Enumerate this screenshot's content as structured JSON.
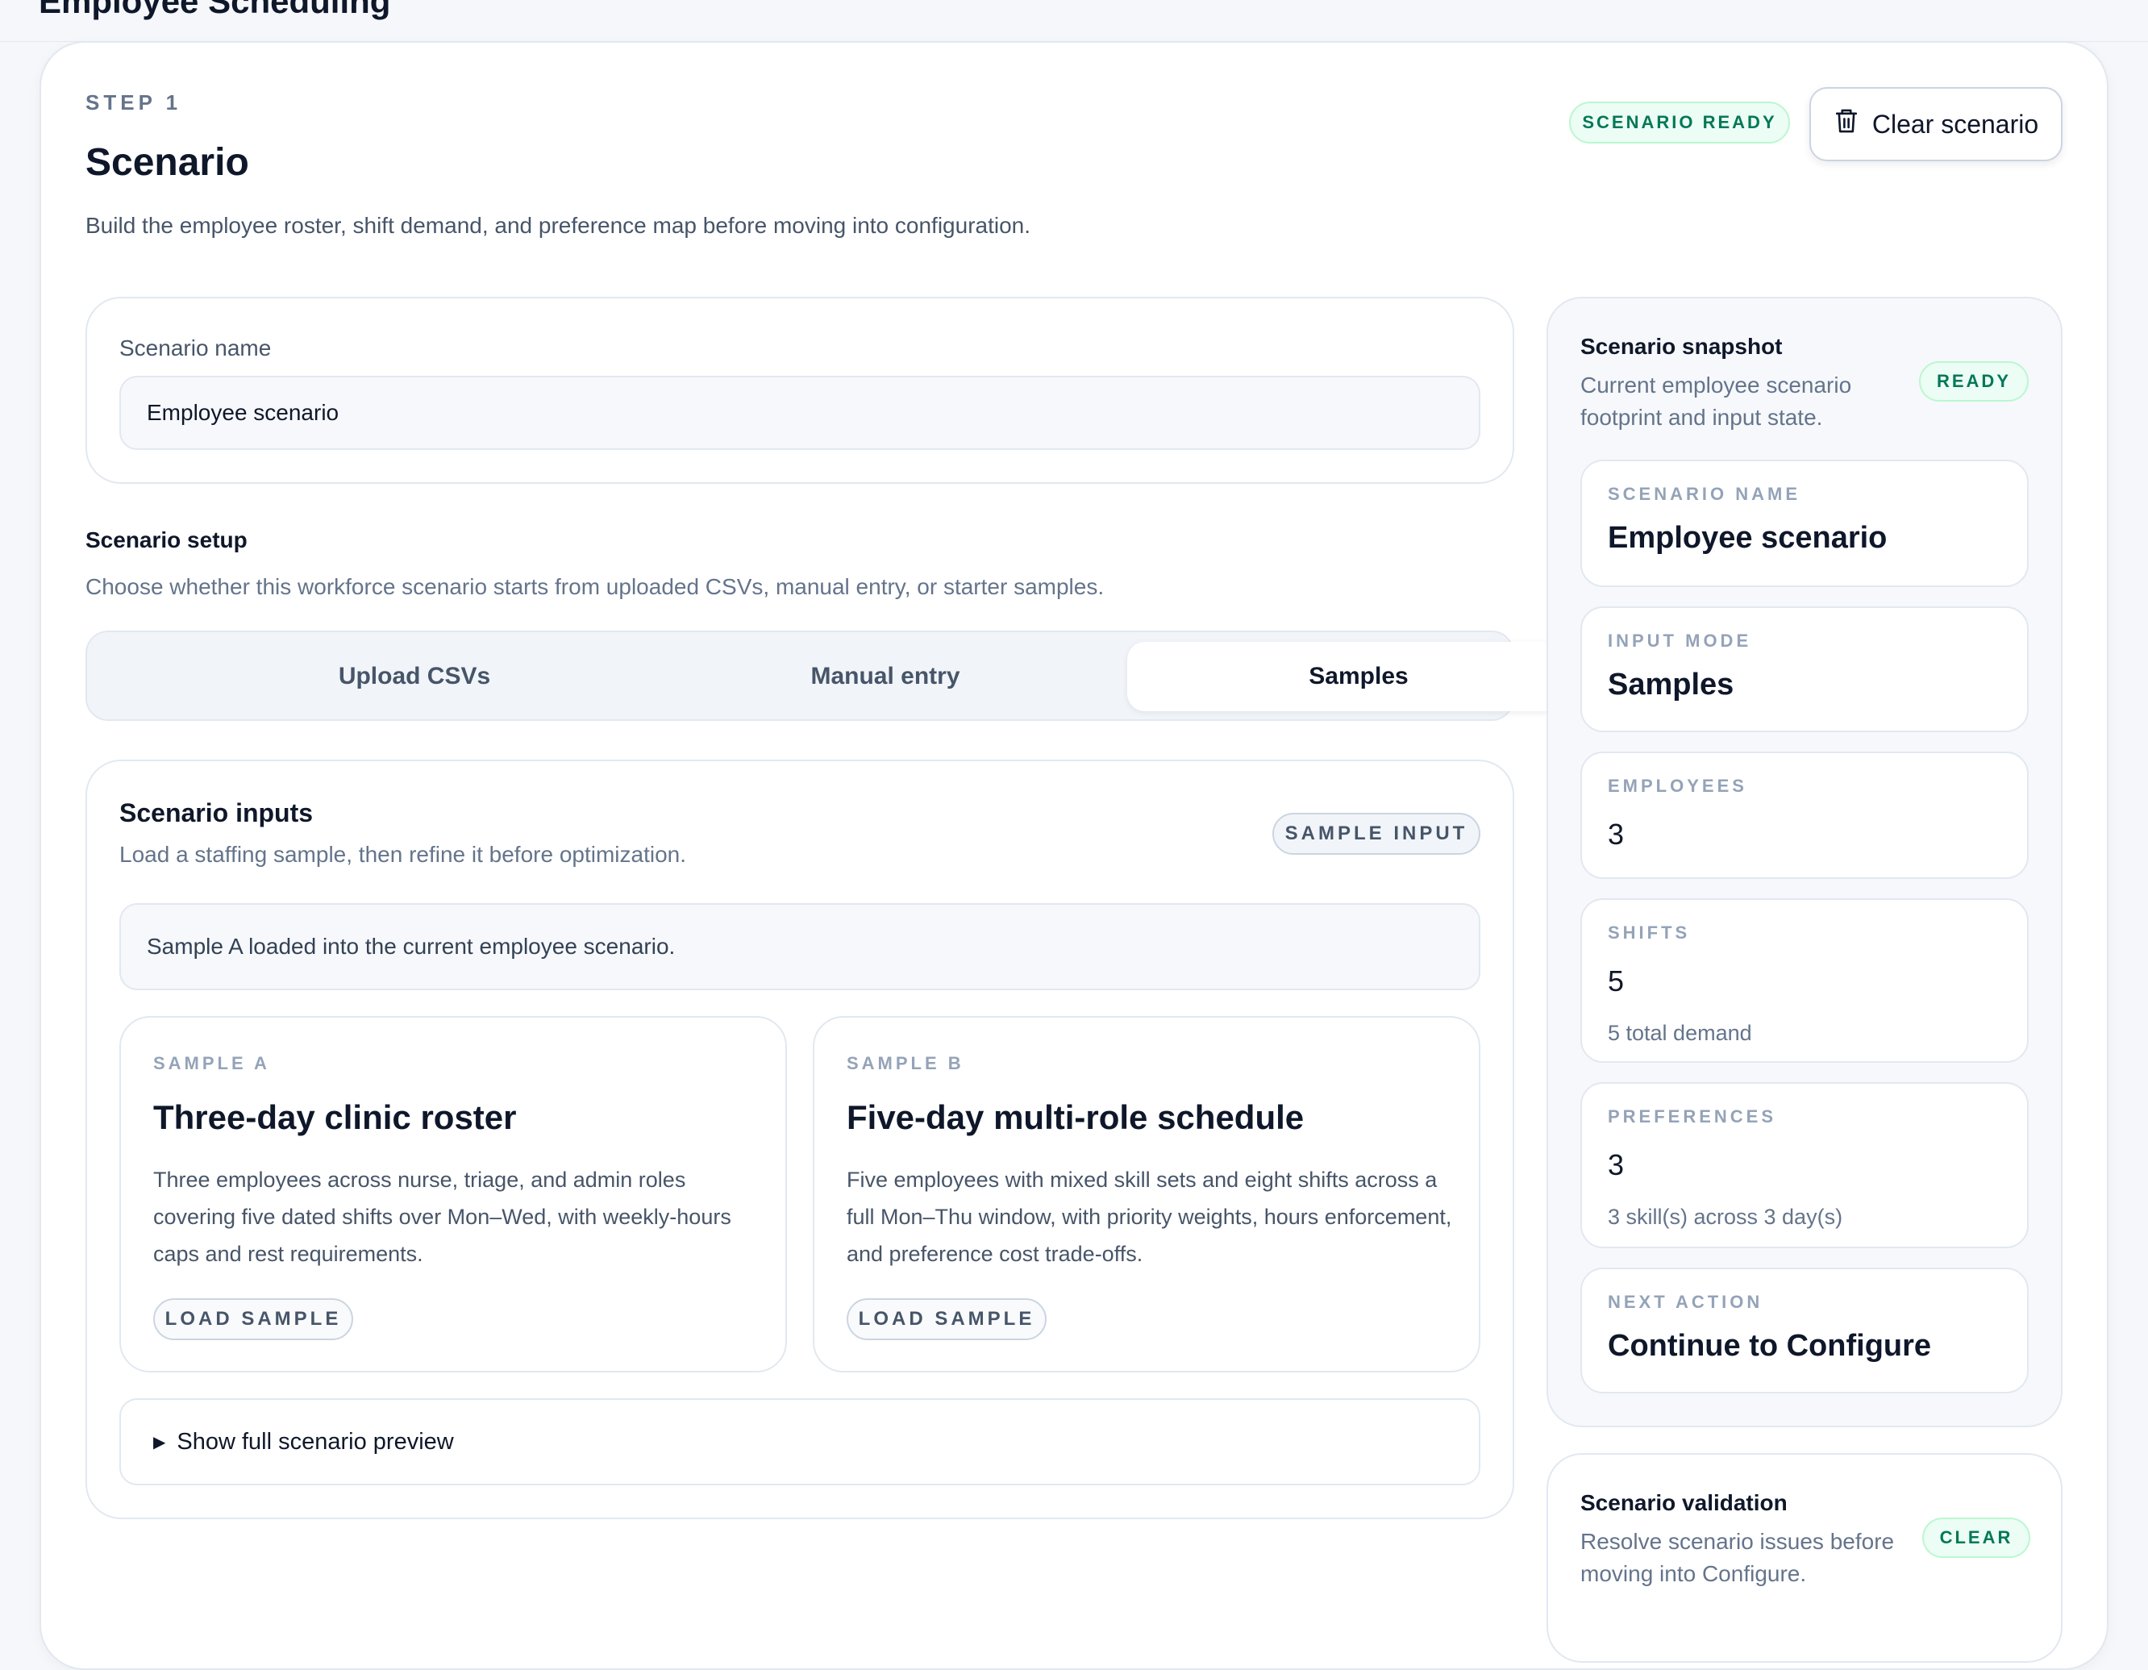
{
  "app": {
    "title": "Employee Scheduling"
  },
  "header": {
    "step": "STEP 1",
    "title": "Scenario",
    "description": "Build the employee roster, shift demand, and preference map before moving into configuration.",
    "status_badge": "SCENARIO READY",
    "clear_button": "Clear scenario"
  },
  "scenario_name": {
    "label": "Scenario name",
    "value": "Employee scenario"
  },
  "setup": {
    "title": "Scenario setup",
    "description": "Choose whether this workforce scenario starts from uploaded CSVs, manual entry, or starter samples.",
    "tabs": [
      {
        "label": "Upload CSVs",
        "active": false
      },
      {
        "label": "Manual entry",
        "active": false
      },
      {
        "label": "Samples",
        "active": true
      }
    ]
  },
  "inputs": {
    "title": "Scenario inputs",
    "description": "Load a staffing sample, then refine it before optimization.",
    "badge": "SAMPLE INPUT",
    "message": "Sample A loaded into the current employee scenario.",
    "samples": [
      {
        "kicker": "SAMPLE A",
        "title": "Three-day clinic roster",
        "text": "Three employees across nurse, triage, and admin roles covering five dated shifts over Mon–Wed, with weekly-hours caps and rest requirements.",
        "button": "LOAD SAMPLE"
      },
      {
        "kicker": "SAMPLE B",
        "title": "Five-day multi-role schedule",
        "text": "Five employees with mixed skill sets and eight shifts across a full Mon–Thu window, with priority weights, hours enforcement, and preference cost trade-offs.",
        "button": "LOAD SAMPLE"
      }
    ],
    "preview_toggle": "Show full scenario preview"
  },
  "snapshot": {
    "title": "Scenario snapshot",
    "description": "Current employee scenario footprint and input state.",
    "badge": "READY",
    "stats": [
      {
        "label": "SCENARIO NAME",
        "value": "Employee scenario",
        "sub": ""
      },
      {
        "label": "INPUT MODE",
        "value": "Samples",
        "sub": ""
      },
      {
        "label": "EMPLOYEES",
        "value": "3",
        "sub": ""
      },
      {
        "label": "SHIFTS",
        "value": "5",
        "sub": "5 total demand"
      },
      {
        "label": "PREFERENCES",
        "value": "3",
        "sub": "3 skill(s) across 3 day(s)"
      },
      {
        "label": "NEXT ACTION",
        "value": "Continue to Configure",
        "sub": ""
      }
    ]
  },
  "validation": {
    "title": "Scenario validation",
    "description": "Resolve scenario issues before moving into Configure.",
    "badge": "CLEAR"
  },
  "colors": {
    "accent_green": "#047857",
    "badge_green_bg": "#ecfdf5",
    "text_primary": "#0f172a",
    "text_muted": "#64748b"
  }
}
